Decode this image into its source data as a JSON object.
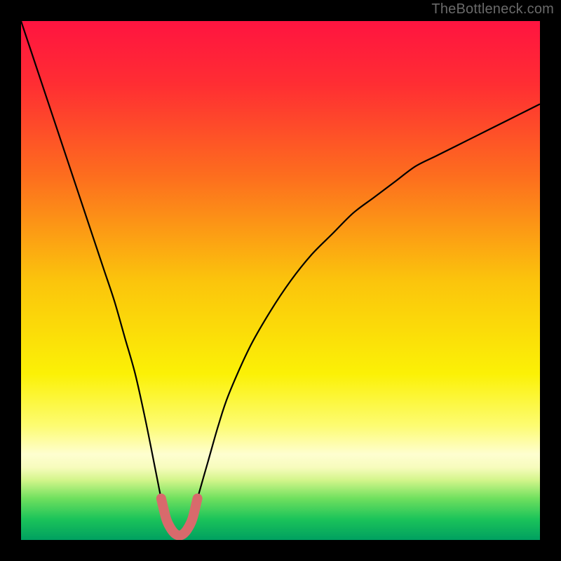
{
  "watermark": "TheBottleneck.com",
  "chart_data": {
    "type": "line",
    "title": "",
    "xlabel": "",
    "ylabel": "",
    "xlim": [
      0,
      100
    ],
    "ylim": [
      0,
      100
    ],
    "x": [
      0,
      2,
      4,
      6,
      8,
      10,
      12,
      14,
      16,
      18,
      20,
      22,
      24,
      26,
      27,
      28,
      29,
      30,
      31,
      32,
      33,
      34,
      36,
      38,
      40,
      44,
      48,
      52,
      56,
      60,
      64,
      68,
      72,
      76,
      80,
      84,
      88,
      92,
      96,
      100
    ],
    "values": [
      100,
      94,
      88,
      82,
      76,
      70,
      64,
      58,
      52,
      46,
      39,
      32,
      23,
      13,
      8,
      4,
      2,
      1,
      1,
      2,
      4,
      8,
      15,
      22,
      28,
      37,
      44,
      50,
      55,
      59,
      63,
      66,
      69,
      72,
      74,
      76,
      78,
      80,
      82,
      84
    ],
    "highlight_band": {
      "x_start": 25,
      "x_end": 34,
      "y_max": 12
    },
    "background_gradient": {
      "stops": [
        {
          "offset": 0.0,
          "color": "#ff1440"
        },
        {
          "offset": 0.12,
          "color": "#ff2d33"
        },
        {
          "offset": 0.3,
          "color": "#fd6e1e"
        },
        {
          "offset": 0.5,
          "color": "#fbc40c"
        },
        {
          "offset": 0.68,
          "color": "#fbf106"
        },
        {
          "offset": 0.78,
          "color": "#fdfc72"
        },
        {
          "offset": 0.835,
          "color": "#fefed0"
        },
        {
          "offset": 0.86,
          "color": "#f7fcbd"
        },
        {
          "offset": 0.885,
          "color": "#d2f58a"
        },
        {
          "offset": 0.92,
          "color": "#6fe05e"
        },
        {
          "offset": 0.96,
          "color": "#1bc35a"
        },
        {
          "offset": 1.0,
          "color": "#00a060"
        }
      ]
    },
    "curve_color": "#000000",
    "highlight_color": "#d86a6c"
  }
}
